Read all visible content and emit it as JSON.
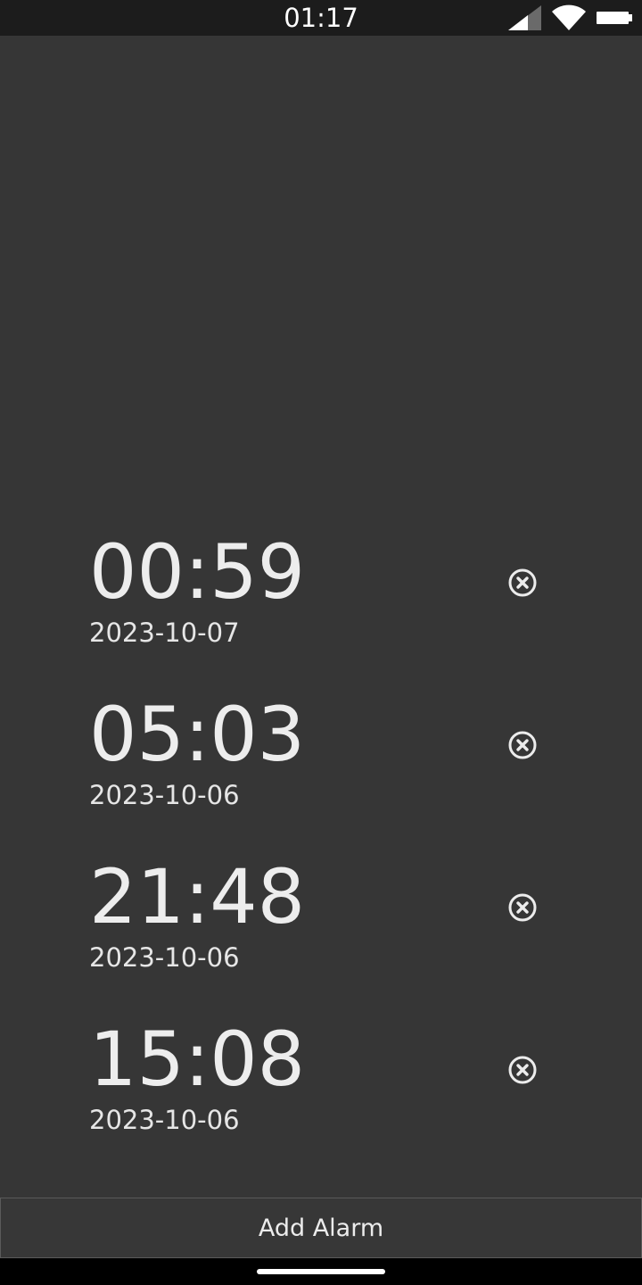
{
  "status_bar": {
    "time": "01:17",
    "icons": [
      "cellular-signal-icon",
      "wifi-icon",
      "battery-icon"
    ]
  },
  "alarms": [
    {
      "time": "00:59",
      "date": "2023-10-07"
    },
    {
      "time": "05:03",
      "date": "2023-10-06"
    },
    {
      "time": "21:48",
      "date": "2023-10-06"
    },
    {
      "time": "15:08",
      "date": "2023-10-06"
    }
  ],
  "add_alarm_label": "Add Alarm",
  "colors": {
    "background": "#363636",
    "status_bar": "#1c1c1c",
    "text": "#ececec",
    "nav_bar": "#000000"
  }
}
